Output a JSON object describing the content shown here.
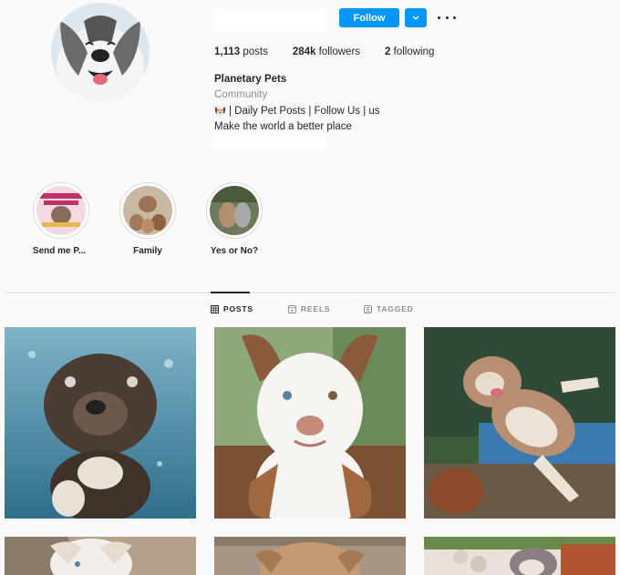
{
  "profile": {
    "follow_label": "Follow",
    "posts_count": "1,113",
    "posts_label": "posts",
    "followers_count": "284k",
    "followers_label": "followers",
    "following_count": "2",
    "following_label": "following",
    "name": "Planetary Pets",
    "category": "Community",
    "bio_line1": "| Daily Pet Posts | Follow Us | us",
    "bio_line2": "Make the world a better place"
  },
  "highlights": [
    {
      "label": "Send me P..."
    },
    {
      "label": "Family"
    },
    {
      "label": "Yes or No?"
    }
  ],
  "tabs": [
    {
      "label": "POSTS",
      "icon": "grid-icon",
      "active": true
    },
    {
      "label": "REELS",
      "icon": "reels-icon",
      "active": false
    },
    {
      "label": "TAGGED",
      "icon": "tagged-icon",
      "active": false
    }
  ],
  "colors": {
    "accent": "#0095f6",
    "background": "#fafafa",
    "text": "#262626",
    "muted": "#8e8e8e"
  }
}
